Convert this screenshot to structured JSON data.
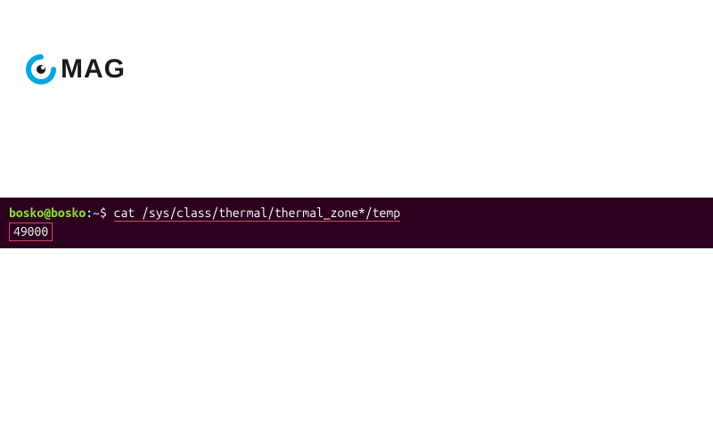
{
  "logo": {
    "text": "MAG"
  },
  "terminal": {
    "prompt": {
      "user": "bosko@bosko",
      "colon": ":",
      "path": "~",
      "dollar": "$"
    },
    "command": "cat /sys/class/thermal/thermal_zone*/temp",
    "output": "49000"
  }
}
